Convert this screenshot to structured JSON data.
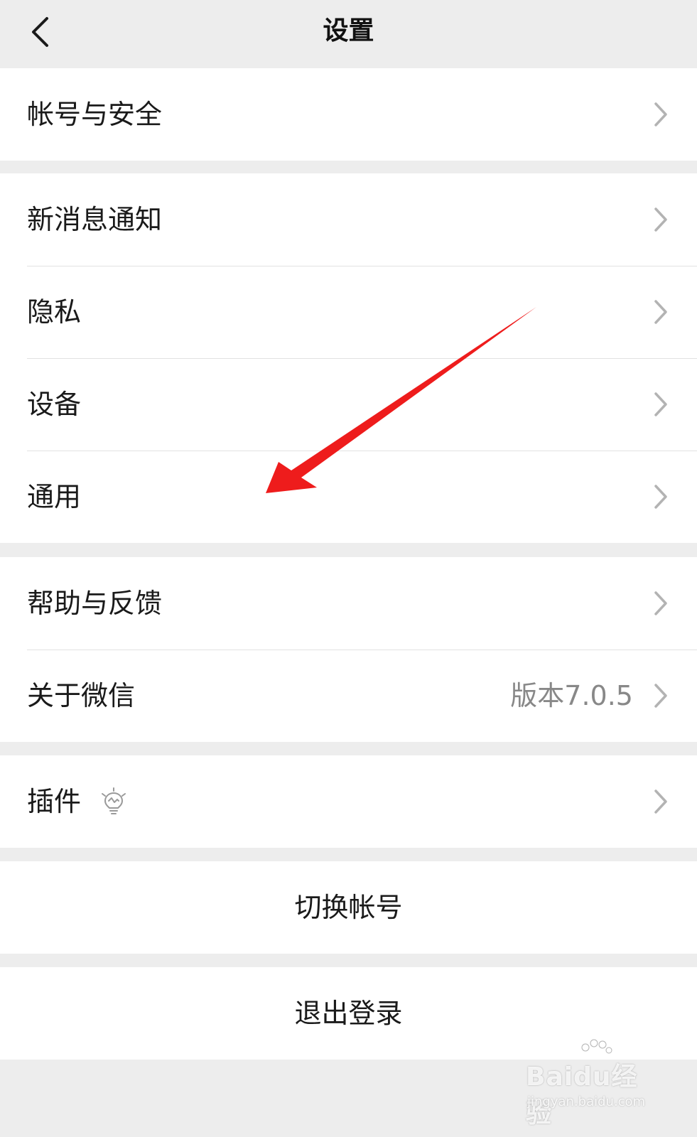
{
  "nav": {
    "title": "设置"
  },
  "groups": [
    {
      "items": [
        {
          "label": "帐号与安全"
        }
      ]
    },
    {
      "items": [
        {
          "label": "新消息通知"
        },
        {
          "label": "隐私"
        },
        {
          "label": "设备"
        },
        {
          "label": "通用"
        }
      ]
    },
    {
      "items": [
        {
          "label": "帮助与反馈"
        },
        {
          "label": "关于微信",
          "value": "版本7.0.5"
        }
      ]
    },
    {
      "items": [
        {
          "label": "插件"
        }
      ]
    }
  ],
  "actions": {
    "switch_account": "切换帐号",
    "logout": "退出登录"
  },
  "icons": {
    "back": "chevron-left-icon",
    "chevron": "chevron-right-icon",
    "plugin": "lightbulb-icon"
  },
  "colors": {
    "background": "#ededed",
    "annotation_arrow": "#ee1c1c"
  },
  "watermark": {
    "brand": "Baidu经验",
    "url": "jingyan.baidu.com"
  }
}
